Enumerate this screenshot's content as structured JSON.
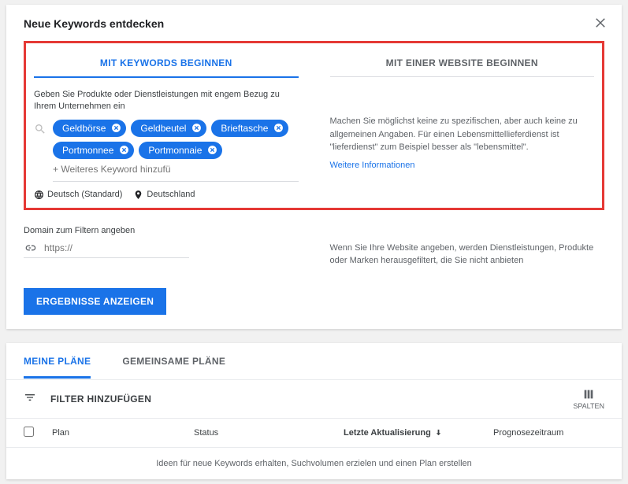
{
  "modal": {
    "title": "Neue Keywords entdecken",
    "tabs": {
      "left": "MIT KEYWORDS BEGINNEN",
      "right": "MIT EINER WEBSITE BEGINNEN"
    },
    "desc": "Geben Sie Produkte oder Dienstleistungen mit engem Bezug zu Ihrem Unternehmen ein",
    "chips": [
      "Geldbörse",
      "Geldbeutel",
      "Brieftasche",
      "Portmonnee",
      "Portmonnaie"
    ],
    "chip_input": "+ Weiteres Keyword hinzufü",
    "lang": "Deutsch (Standard)",
    "loc": "Deutschland",
    "right_desc": "Machen Sie möglichst keine zu spezifischen, aber auch keine zu allgemeinen Angaben. Für einen Lebensmittellieferdienst ist \"lieferdienst\" zum Beispiel besser als \"lebensmittel\".",
    "more_info": "Weitere Informationen",
    "domain_label": "Domain zum Filtern angeben",
    "domain_placeholder": "https://",
    "domain_desc": "Wenn Sie Ihre Website angeben, werden Dienstleistungen, Produkte oder Marken herausgefiltert, die Sie nicht anbieten",
    "submit": "ERGEBNISSE ANZEIGEN"
  },
  "panel": {
    "tabs": {
      "mine": "MEINE PLÄNE",
      "shared": "GEMEINSAME PLÄNE"
    },
    "filter": "FILTER HINZUFÜGEN",
    "cols": "SPALTEN",
    "headers": {
      "plan": "Plan",
      "status": "Status",
      "update": "Letzte Aktualisierung",
      "prog": "Prognosezeitraum"
    },
    "footer": "Ideen für neue Keywords erhalten, Suchvolumen erzielen und einen Plan erstellen"
  }
}
